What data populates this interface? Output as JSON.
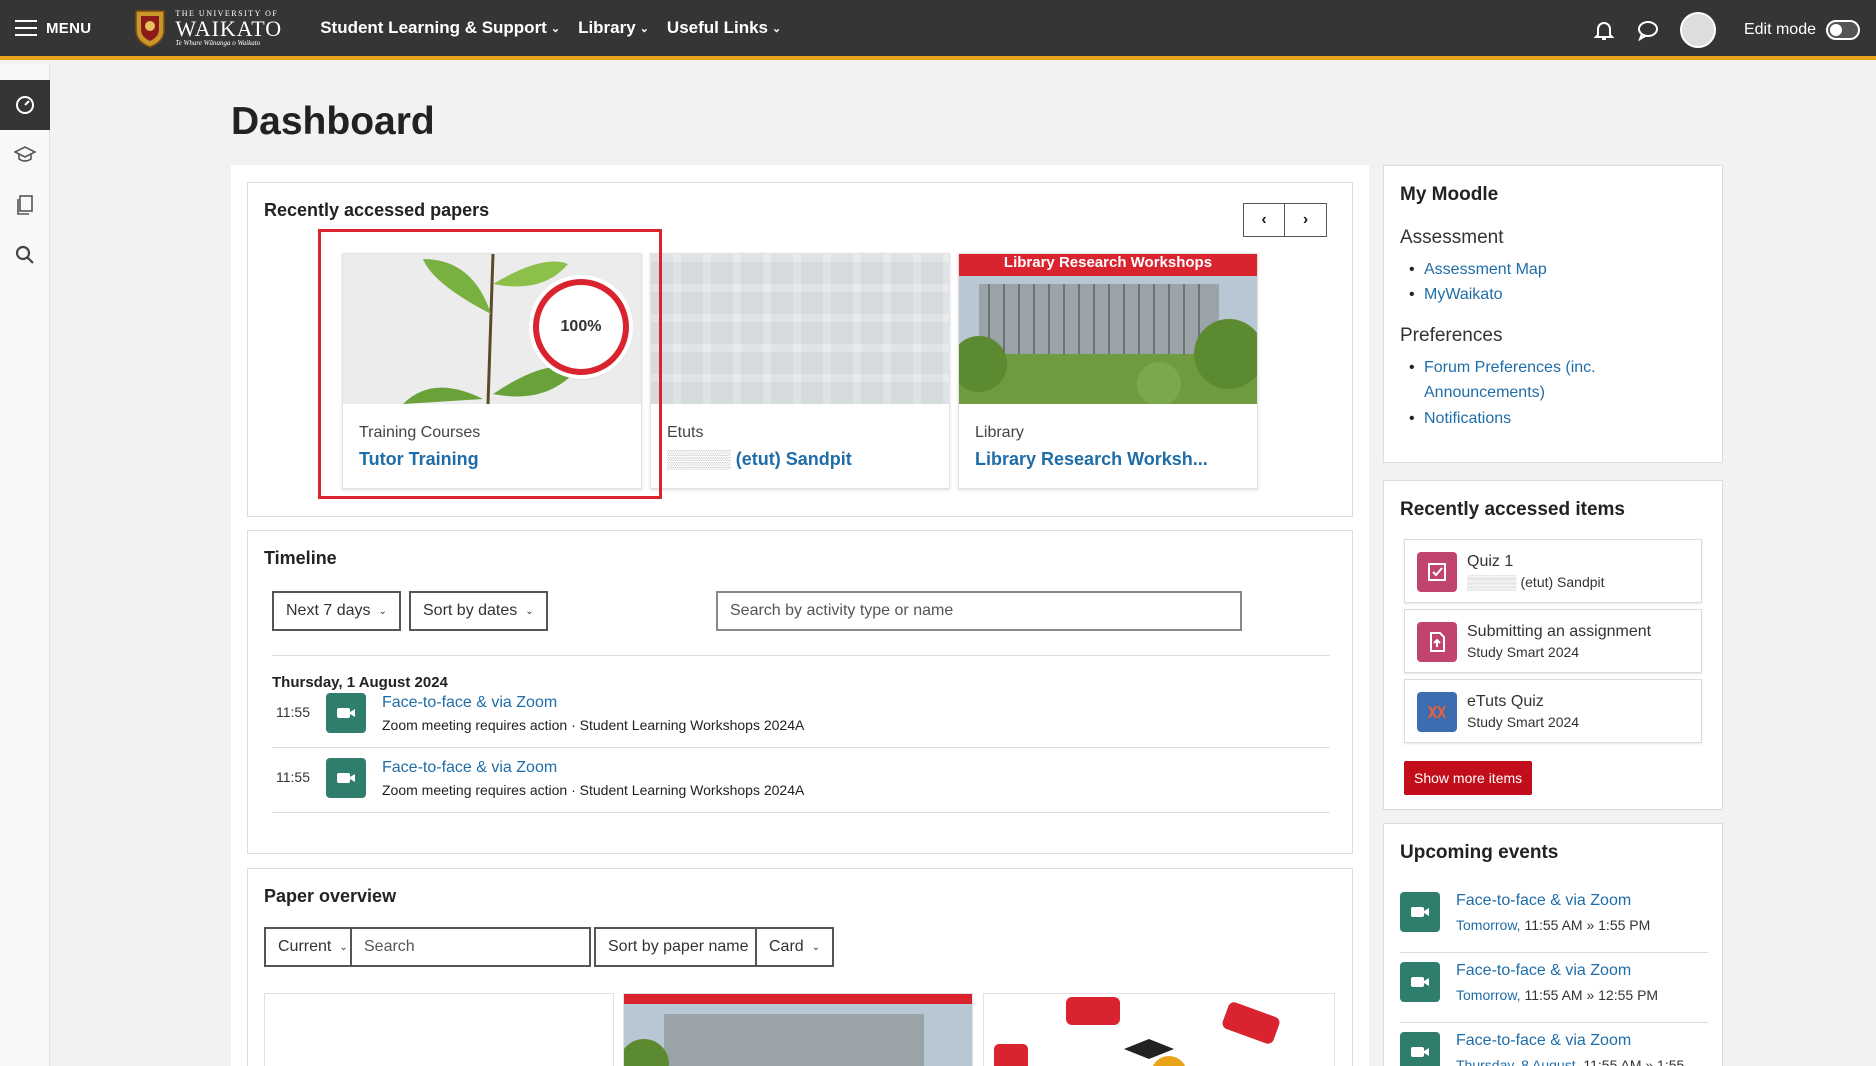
{
  "navbar": {
    "menu_label": "MENU",
    "logo_small": "THE UNIVERSITY OF",
    "logo_big": "WAIKATO",
    "logo_motto": "Te Whare Wānanga o Waikato",
    "links": [
      "Student Learning & Support",
      "Library",
      "Useful Links"
    ],
    "edit_mode_label": "Edit mode"
  },
  "page_title": "Dashboard",
  "recent_papers": {
    "title": "Recently accessed papers",
    "cards": [
      {
        "category": "Training Courses",
        "name": "Tutor Training",
        "progress": "100%"
      },
      {
        "category": "Etuts",
        "name": "(etut) Sandpit"
      },
      {
        "category": "Library",
        "name": "Library Research Worksh...",
        "banner": "Library Research Workshops"
      }
    ]
  },
  "timeline": {
    "title": "Timeline",
    "filter_days": "Next 7 days",
    "sort": "Sort by dates",
    "search_placeholder": "Search by activity type or name",
    "date": "Thursday, 1 August 2024",
    "items": [
      {
        "time": "11:55",
        "name": "Face-to-face & via Zoom",
        "action": "Zoom meeting requires action",
        "course": "Student Learning Workshops 2024A"
      },
      {
        "time": "11:55",
        "name": "Face-to-face & via Zoom",
        "action": "Zoom meeting requires action",
        "course": "Student Learning Workshops 2024A"
      }
    ]
  },
  "paper_overview": {
    "title": "Paper overview",
    "filter": "Current",
    "search_placeholder": "Search",
    "sort": "Sort by paper name",
    "view": "Card"
  },
  "my_moodle": {
    "title": "My Moodle",
    "assessment_heading": "Assessment",
    "assessment_links": [
      "Assessment Map",
      "MyWaikato"
    ],
    "preferences_heading": "Preferences",
    "preferences_links": [
      "Forum Preferences (inc.",
      "Announcements)",
      "Notifications"
    ]
  },
  "recent_items": {
    "title": "Recently accessed items",
    "items": [
      {
        "name": "Quiz 1",
        "course": "(etut) Sandpit"
      },
      {
        "name": "Submitting an assignment",
        "course": "Study Smart 2024"
      },
      {
        "name": "eTuts Quiz",
        "course": "Study Smart 2024"
      }
    ],
    "show_more": "Show more items"
  },
  "upcoming": {
    "title": "Upcoming events",
    "events": [
      {
        "name": "Face-to-face & via Zoom",
        "day": "Tomorrow,",
        "time": "11:55 AM » 1:55 PM"
      },
      {
        "name": "Face-to-face & via Zoom",
        "day": "Tomorrow,",
        "time": "11:55 AM » 12:55 PM"
      },
      {
        "name": "Face-to-face & via Zoom",
        "day": "Thursday, 8 August,",
        "time": "11:55 AM » 1:55"
      }
    ]
  },
  "colors": {
    "accent_bar": "#e8a319",
    "link": "#1f6da8",
    "highlight": "#d9232e",
    "zoom": "#2f7d6d"
  }
}
